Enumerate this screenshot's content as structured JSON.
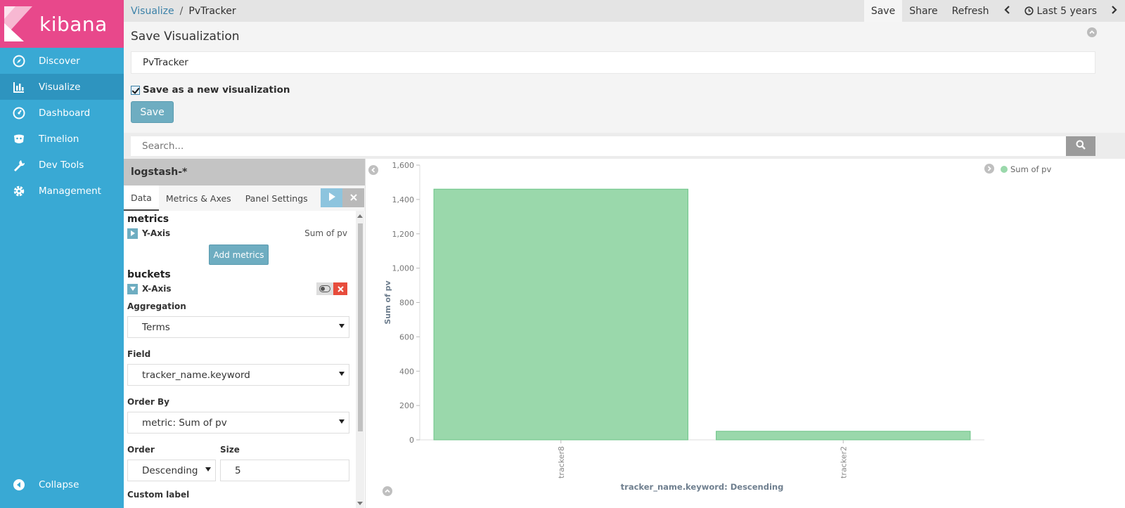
{
  "app": {
    "brand": "kibana"
  },
  "nav": [
    {
      "label": "Discover",
      "icon": "compass-icon",
      "active": false
    },
    {
      "label": "Visualize",
      "icon": "bar-chart-icon",
      "active": true
    },
    {
      "label": "Dashboard",
      "icon": "gauge-icon",
      "active": false
    },
    {
      "label": "Timelion",
      "icon": "timelion-icon",
      "active": false
    },
    {
      "label": "Dev Tools",
      "icon": "wrench-icon",
      "active": false
    },
    {
      "label": "Management",
      "icon": "gear-icon",
      "active": false
    }
  ],
  "collapse_label": "Collapse",
  "breadcrumb": {
    "parent": "Visualize",
    "separator": "/",
    "current": "PvTracker"
  },
  "topbar": {
    "save": "Save",
    "share": "Share",
    "refresh": "Refresh",
    "timerange": "Last 5 years"
  },
  "save_panel": {
    "title": "Save Visualization",
    "name_value": "PvTracker",
    "new_vis_label": "Save as a new visualization",
    "new_vis_checked": true,
    "save_label": "Save"
  },
  "search": {
    "placeholder": "Search..."
  },
  "editor": {
    "index_pattern": "logstash-*",
    "tabs": [
      "Data",
      "Metrics & Axes",
      "Panel Settings"
    ],
    "metrics_heading": "metrics",
    "y_axis": {
      "title": "Y-Axis",
      "desc": "Sum of pv"
    },
    "add_metrics": "Add metrics",
    "buckets_heading": "buckets",
    "x_axis": {
      "title": "X-Axis"
    },
    "aggregation_label": "Aggregation",
    "aggregation_value": "Terms",
    "field_label": "Field",
    "field_value": "tracker_name.keyword",
    "order_by_label": "Order By",
    "order_by_value": "metric: Sum of pv",
    "order_label": "Order",
    "order_value": "Descending",
    "size_label": "Size",
    "size_value": "5",
    "custom_label": "Custom label"
  },
  "chart_data": {
    "type": "bar",
    "categories": [
      "tracker8",
      "tracker2"
    ],
    "series": [
      {
        "name": "Sum of pv",
        "values": [
          1460,
          50
        ],
        "color": "#9ad8ab"
      }
    ],
    "title": "",
    "xlabel": "tracker_name.keyword: Descending",
    "ylabel": "Sum of pv",
    "ylim": [
      0,
      1600
    ],
    "yticks": [
      0,
      200,
      400,
      600,
      800,
      1000,
      1200,
      1400,
      1600
    ],
    "ytick_labels": [
      "0",
      "200",
      "400",
      "600",
      "800",
      "1,000",
      "1,200",
      "1,400",
      "1,600"
    ],
    "legend": "top-right",
    "grid": false
  },
  "colors": {
    "sidebar": "#39a9d4",
    "logo_bg": "#e8488b",
    "accent": "#6eadc1",
    "bar": "#9ad8ab",
    "bar_stroke": "#6cc487",
    "danger": "#e74c3c"
  }
}
